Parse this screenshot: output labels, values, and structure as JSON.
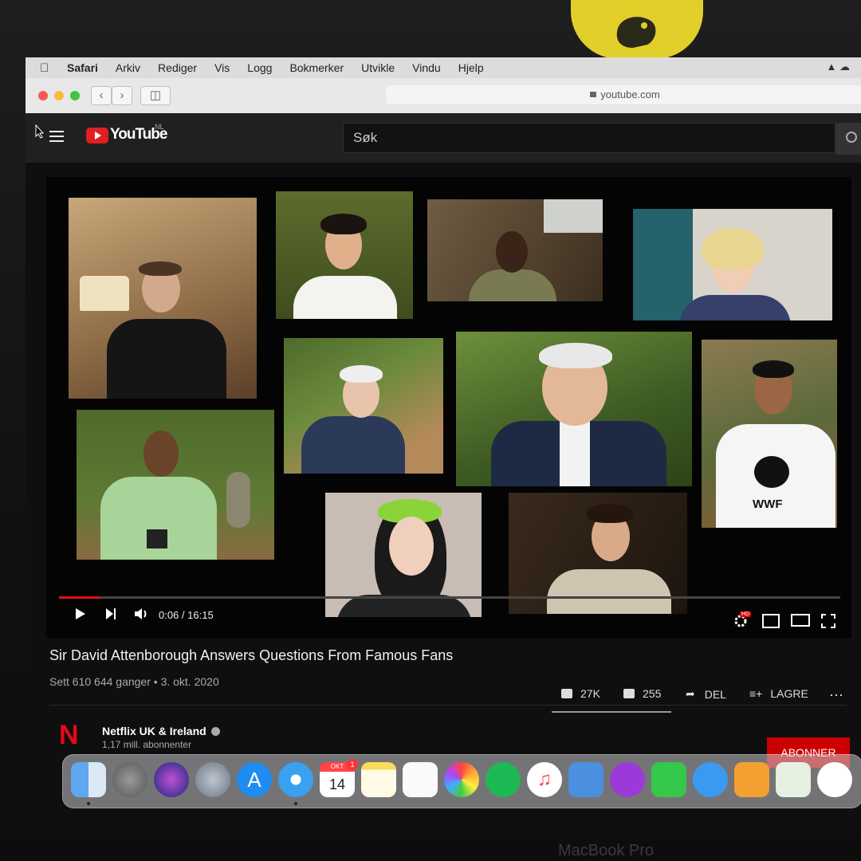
{
  "menubar": {
    "items": [
      "Safari",
      "Arkiv",
      "Rediger",
      "Vis",
      "Logg",
      "Bokmerker",
      "Utvikle",
      "Vindu",
      "Hjelp"
    ]
  },
  "safari": {
    "address": "youtube.com"
  },
  "youtube": {
    "logo_text": "YouTube",
    "region": "NL",
    "search_placeholder": "Søk"
  },
  "player": {
    "time": "0:06 / 16:15",
    "progress": 0.006,
    "hd_badge": "HD",
    "icons": [
      "play-icon",
      "next-icon",
      "volume-icon",
      "settings-icon",
      "miniplayer-icon",
      "theater-icon",
      "fullscreen-icon"
    ]
  },
  "video": {
    "title": "Sir David Attenborough Answers Questions From Famous Fans",
    "meta": "Sett 610 644 ganger • 3. okt. 2020",
    "likes": "27K",
    "dislikes": "255",
    "share": "DEL",
    "save": "LAGRE"
  },
  "tiles": [
    {
      "id": "tile-1"
    },
    {
      "id": "tile-2"
    },
    {
      "id": "tile-3"
    },
    {
      "id": "tile-4"
    },
    {
      "id": "tile-5"
    },
    {
      "id": "tile-6"
    },
    {
      "id": "tile-7"
    },
    {
      "id": "tile-8"
    },
    {
      "id": "tile-9"
    },
    {
      "id": "tile-10"
    },
    {
      "id": "tile-11"
    }
  ],
  "tshirt_text": "WWF",
  "channel": {
    "logo": "N",
    "name": "Netflix UK & Ireland",
    "subscribers": "1,17 mill. abonnenter",
    "subscribe": "ABONNER"
  },
  "dock": {
    "calendar_month": "OKT",
    "calendar_day": "14",
    "calendar_badge": "1",
    "apps": [
      "finder-icon",
      "system-preferences-icon",
      "siri-icon",
      "launchpad-icon",
      "app-store-icon",
      "safari-icon",
      "calendar-icon",
      "notes-icon",
      "reminders-icon",
      "photos-icon",
      "spotify-icon",
      "music-icon",
      "keynote-icon",
      "podcasts-icon",
      "facetime-icon",
      "messages-icon",
      "pages-icon",
      "numbers-icon",
      "slack-icon"
    ]
  },
  "laptop_brand": "MacBook Pro",
  "colors": {
    "youtube_red": "#e02020",
    "subscribe_red": "#cc0000",
    "sticker_yellow": "#e3cf2a"
  }
}
